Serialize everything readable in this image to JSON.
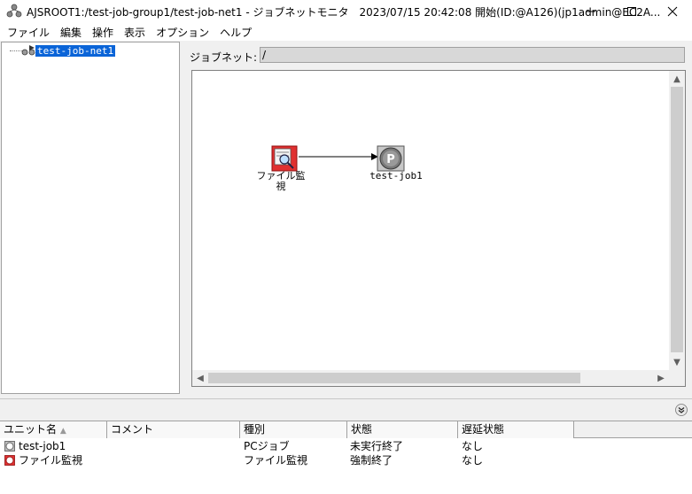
{
  "window": {
    "title": "AJSROOT1:/test-job-group1/test-job-net1 - ジョブネットモニタ　2023/07/15 20:42:08 開始(ID:@A126)(jp1admin@EC2A..."
  },
  "menu": [
    "ファイル",
    "編集",
    "操作",
    "表示",
    "オプション",
    "ヘルプ"
  ],
  "tree": {
    "label": "test-job-net1"
  },
  "jobnet": {
    "label": "ジョブネット:",
    "path": "/"
  },
  "canvas_units": {
    "filewatch_label": "ファイル監\n視",
    "job1_label": "test-job1"
  },
  "list": {
    "headers": [
      "ユニット名",
      "コメント",
      "種別",
      "状態",
      "遅延状態"
    ],
    "sort_indicator": "▲",
    "rows": [
      {
        "name": "test-job1",
        "comment": "",
        "type": "PCジョブ",
        "status": "未実行終了",
        "delay": "なし",
        "icon_color": "#808080"
      },
      {
        "name": "ファイル監視",
        "comment": "",
        "type": "ファイル監視",
        "status": "強制終了",
        "delay": "なし",
        "icon_color": "#e03030"
      }
    ]
  },
  "colors": {
    "selection": "#0a64d8",
    "filewatch_red": "#e03030",
    "job_gray": "#7a7a7a"
  }
}
